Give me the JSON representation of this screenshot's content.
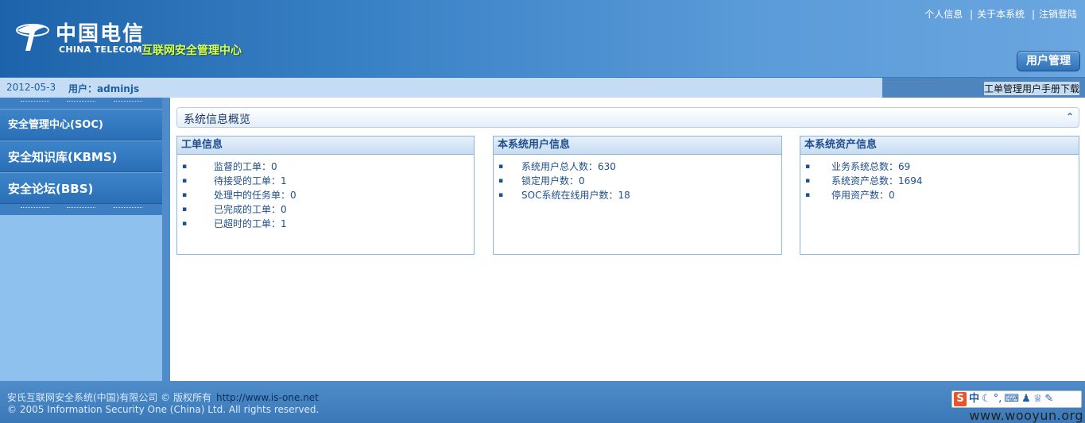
{
  "header": {
    "logo_cn": "中国电信",
    "logo_en": "CHINA TELECOM",
    "logo_sub": "互联网安全管理中心",
    "top_links": [
      "个人信息",
      "关于本系统",
      "注销登陆"
    ],
    "user_mgmt_button": "用户管理"
  },
  "statusbar": {
    "date": "2012-05-3",
    "user": "用户：adminjs",
    "manual_link": "工单管理用户手册下载"
  },
  "sidebar": {
    "items": [
      {
        "label": "安全管理中心(SOC)"
      },
      {
        "label": "安全知识库(KBMS)"
      },
      {
        "label": "安全论坛(BBS)"
      }
    ]
  },
  "main": {
    "overview_title": "系统信息概览",
    "collapse_icon": "double-chevron-up-icon",
    "panels": [
      {
        "title": "工单信息",
        "items": [
          "监督的工单：0",
          "待接受的工单：1",
          "处理中的任务单：0",
          "已完成的工单：0",
          "已超时的工单：1"
        ]
      },
      {
        "title": "本系统用户信息",
        "items": [
          "系统用户总人数：630",
          "锁定用户数：0",
          "SOC系统在线用户数：18"
        ]
      },
      {
        "title": "本系统资产信息",
        "items": [
          "业务系统总数：69",
          "系统资产总数：1694",
          "停用资产数：0"
        ]
      }
    ]
  },
  "footer": {
    "company": "安氏互联网安全系统(中国)有限公司 © 版权所有",
    "url": "http://www.is-one.net",
    "copyright": "© 2005 Information Security One (China) Ltd. All rights reserved.",
    "ime": {
      "logo": "S",
      "mode": "中"
    },
    "watermark": "www.wooyun.org"
  }
}
